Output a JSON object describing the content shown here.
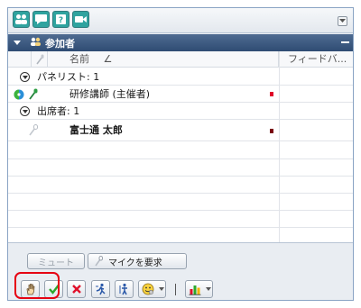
{
  "header": {
    "title": "参加者"
  },
  "columns": {
    "name": "名前",
    "sort_indicator": "∠",
    "feedback": "フィードバ..."
  },
  "groups": {
    "panelists": {
      "label": "パネリスト: 1"
    },
    "attendees": {
      "label": "出席者: 1"
    }
  },
  "participants": [
    {
      "name": "研修講師 (主催者)",
      "group": "panelists"
    },
    {
      "name": "富士通 太郎",
      "group": "attendees"
    }
  ],
  "buttons": {
    "mute": "ミュート",
    "request_mic": "マイクを要求"
  },
  "colors": {
    "header": "#3a5880",
    "highlight": "#e60012",
    "red_mark": "#e0002a",
    "dark_mark": "#7a0010"
  }
}
